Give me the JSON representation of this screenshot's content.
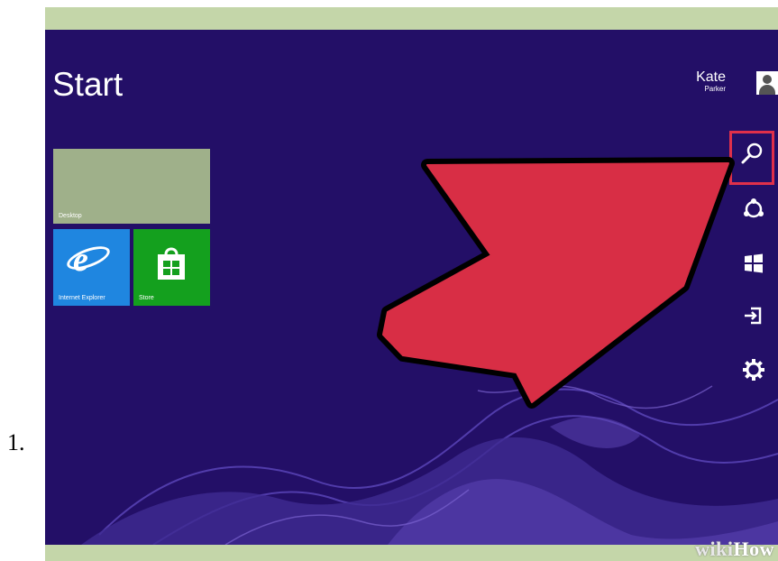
{
  "step": {
    "number": "1."
  },
  "start_screen": {
    "title": "Start",
    "user": {
      "first_name": "Kate",
      "last_name": "Parker"
    },
    "tiles": [
      {
        "label": "Desktop",
        "color": "#9fb08a"
      },
      {
        "label": "Internet Explorer",
        "color": "#1f86e0",
        "icon": "internet-explorer-icon"
      },
      {
        "label": "Store",
        "color": "#14a01e",
        "icon": "store-bag-icon"
      }
    ],
    "charms": [
      {
        "name": "Search",
        "icon": "search-icon",
        "highlighted": true
      },
      {
        "name": "Share",
        "icon": "share-icon"
      },
      {
        "name": "Start",
        "icon": "windows-logo-icon"
      },
      {
        "name": "Devices",
        "icon": "devices-icon"
      },
      {
        "name": "Settings",
        "icon": "gear-icon"
      }
    ],
    "background_color": "#230f67",
    "highlight_color": "#e0304a",
    "arrow_color": "#d82e45"
  },
  "watermark": {
    "wiki": "wiki",
    "how": "How"
  }
}
